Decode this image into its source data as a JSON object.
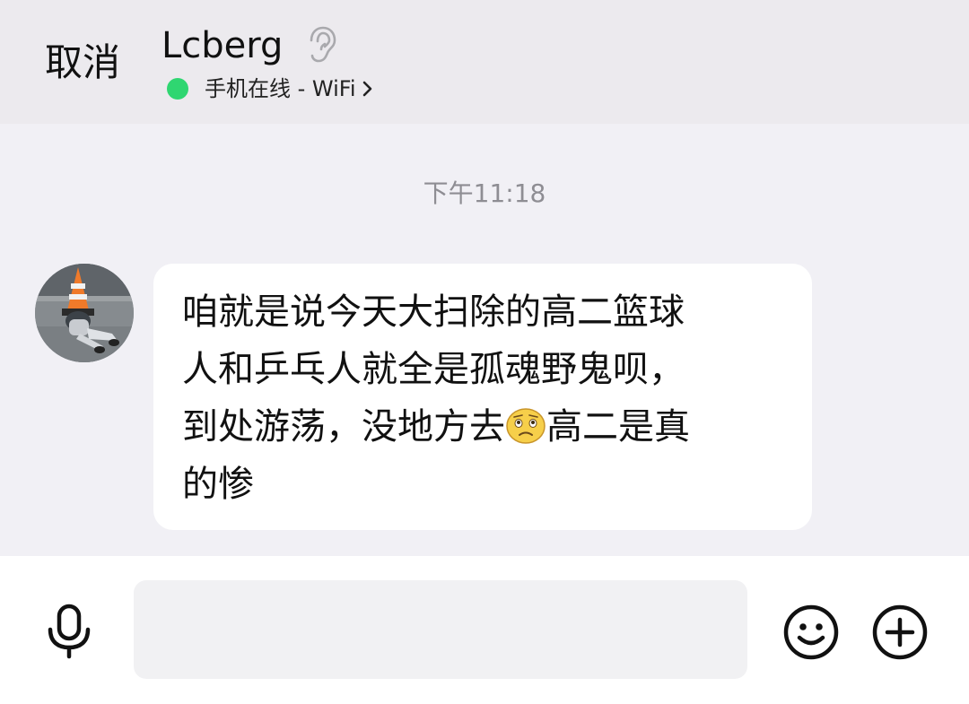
{
  "header": {
    "cancel_label": "取消",
    "contact_name": "Lcberg",
    "status_text": "手机在线 - WiFi",
    "status_color": "#2fd671",
    "ear_icon": "ear-icon",
    "chevron_icon": "chevron-right-icon"
  },
  "conversation": {
    "timestamp": "下午11:18",
    "messages": [
      {
        "sender": "Lcberg",
        "avatar_icon": "avatar-photo",
        "lines": [
          "咱就是说今天大扫除的高二篮球",
          "人和乒乓人就全是孤魂野鬼呗，",
          "到处游荡，没地方去",
          "的惨"
        ],
        "line3_after_emoji": "高二是真",
        "inline_emoji": "sad-face-emoji"
      }
    ]
  },
  "input_bar": {
    "voice_icon": "microphone-icon",
    "text_value": "",
    "emoji_icon": "smiley-icon",
    "more_icon": "plus-circle-icon"
  }
}
